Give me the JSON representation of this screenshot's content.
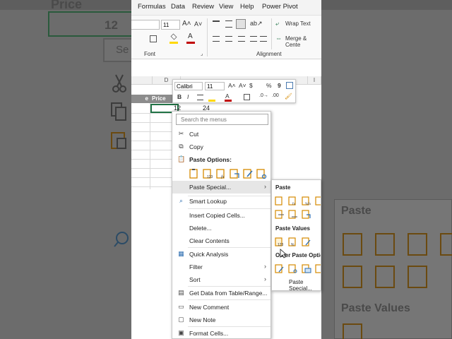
{
  "menubar": {
    "tabs": [
      "Formulas",
      "Data",
      "Review",
      "View",
      "Help",
      "Power Pivot"
    ]
  },
  "ribbon": {
    "font_size": "11",
    "wrap_text": "Wrap Text",
    "merge_center": "Merge & Cente",
    "group_font": "Font",
    "group_alignment": "Alignment"
  },
  "sheet": {
    "col_d": "D",
    "col_i": "I",
    "header_price": "Price",
    "header_e": "e",
    "cell_value_1": "12",
    "cell_value_2": "24"
  },
  "mini_toolbar": {
    "font_name": "Calibri",
    "font_size": "11",
    "bold": "B",
    "italic": "I",
    "currency": "$",
    "percent": "%",
    "comma": "9"
  },
  "context_menu": {
    "search_placeholder": "Search the menus",
    "cut": "Cut",
    "copy": "Copy",
    "paste_options": "Paste Options:",
    "paste_special": "Paste Special...",
    "smart_lookup": "Smart Lookup",
    "insert_copied_cells": "Insert Copied Cells...",
    "delete": "Delete...",
    "clear_contents": "Clear Contents",
    "quick_analysis": "Quick Analysis",
    "filter": "Filter",
    "sort": "Sort",
    "get_data": "Get Data from Table/Range...",
    "new_comment": "New Comment",
    "new_note": "New Note",
    "format_cells": "Format Cells..."
  },
  "submenu": {
    "paste": "Paste",
    "paste_values": "Paste Values",
    "other_paste_options": "Other Paste Options",
    "paste_special": "Paste Special..."
  },
  "background": {
    "price": "Price",
    "value": "12",
    "search_fragment": "Se",
    "paste": "Paste",
    "paste_values": "Paste Values"
  },
  "colors": {
    "accent": "#d68a00",
    "ribbon_green": "#217346",
    "font_red": "#c00000",
    "highlight_yellow": "#ffd800"
  }
}
